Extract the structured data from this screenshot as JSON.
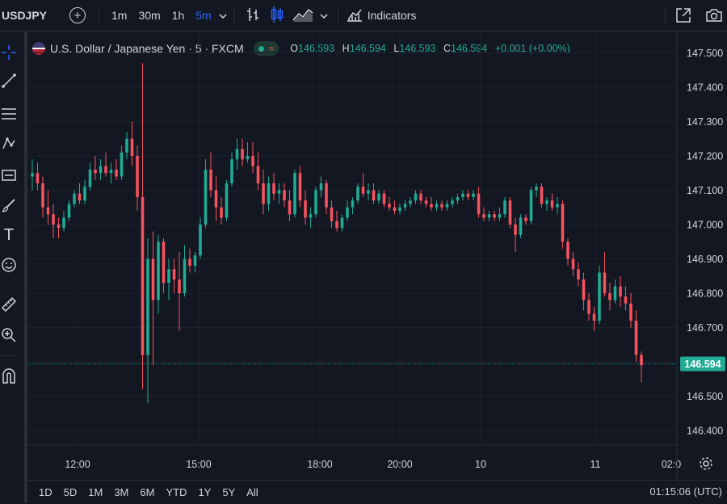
{
  "toolbar": {
    "symbol": "USDJPY",
    "intervals": [
      "1m",
      "30m",
      "1h",
      "5m"
    ],
    "active_interval": "5m",
    "indicators_label": "Indicators"
  },
  "legend": {
    "title": "U.S. Dollar / Japanese Yen · 5 · FXCM",
    "wave_glyph": "≈",
    "open_label": "O",
    "open": "146.593",
    "high_label": "H",
    "high": "146.594",
    "low_label": "L",
    "low": "146.593",
    "close_label": "C",
    "close": "146.594",
    "change": "+0.001 (+0.00%)"
  },
  "bottom": {
    "ranges": [
      "1D",
      "5D",
      "1M",
      "3M",
      "6M",
      "YTD",
      "1Y",
      "5Y",
      "All"
    ],
    "clock": "01:15:06 (UTC)"
  },
  "colors": {
    "background": "#131722",
    "up": "#22ab94",
    "down": "#f7525f",
    "grid": "#1e222d",
    "text": "#d1d4dc",
    "active": "#2962ff"
  },
  "chart_data": {
    "type": "candlestick",
    "title": "U.S. Dollar / Japanese Yen · 5 · FXCM",
    "ylim": [
      146.36,
      147.56
    ],
    "y_ticks": [
      "147.500",
      "147.400",
      "147.300",
      "147.200",
      "147.100",
      "147.000",
      "146.900",
      "146.800",
      "146.700",
      "146.600",
      "146.500",
      "146.400"
    ],
    "x_ticks": [
      "12:00",
      "15:00",
      "18:00",
      "20:00",
      "10",
      "11",
      "02:0"
    ],
    "last_price": "146.594",
    "close_path": [
      147.15,
      147.12,
      147.03,
      146.99,
      147.02,
      147.06,
      147.11,
      147.16,
      147.18,
      147.15,
      147.22,
      147.27,
      147.12,
      146.98,
      146.6,
      146.92,
      146.88,
      146.85,
      146.95,
      147.02,
      147.15,
      147.18,
      147.12,
      147.05,
      147.1,
      147.2,
      147.24,
      147.19,
      147.12,
      147.09,
      147.16,
      147.1,
      147.05,
      147.0,
      147.06,
      147.12,
      147.1,
      147.06,
      147.05,
      147.08,
      147.1,
      147.06,
      147.05,
      147.06,
      147.1,
      147.06,
      147.07,
      147.01,
      147.04,
      147.09,
      147.11,
      147.07,
      146.93,
      146.86,
      146.78,
      146.73,
      146.83,
      146.87,
      146.78,
      146.74,
      146.59
    ],
    "candles": [
      {
        "o": 147.14,
        "h": 147.19,
        "l": 147.1,
        "c": 147.15
      },
      {
        "o": 147.15,
        "h": 147.18,
        "l": 147.1,
        "c": 147.12
      },
      {
        "o": 147.12,
        "h": 147.14,
        "l": 147.02,
        "c": 147.05
      },
      {
        "o": 147.05,
        "h": 147.1,
        "l": 147.0,
        "c": 147.03
      },
      {
        "o": 147.03,
        "h": 147.06,
        "l": 146.96,
        "c": 147.0
      },
      {
        "o": 147.0,
        "h": 147.02,
        "l": 146.96,
        "c": 146.99
      },
      {
        "o": 146.99,
        "h": 147.04,
        "l": 146.98,
        "c": 147.02
      },
      {
        "o": 147.02,
        "h": 147.07,
        "l": 147.01,
        "c": 147.06
      },
      {
        "o": 147.06,
        "h": 147.1,
        "l": 147.05,
        "c": 147.09
      },
      {
        "o": 147.09,
        "h": 147.12,
        "l": 147.06,
        "c": 147.07
      },
      {
        "o": 147.07,
        "h": 147.13,
        "l": 147.06,
        "c": 147.11
      },
      {
        "o": 147.11,
        "h": 147.18,
        "l": 147.1,
        "c": 147.16
      },
      {
        "o": 147.16,
        "h": 147.2,
        "l": 147.13,
        "c": 147.15
      },
      {
        "o": 147.15,
        "h": 147.19,
        "l": 147.13,
        "c": 147.17
      },
      {
        "o": 147.17,
        "h": 147.21,
        "l": 147.14,
        "c": 147.15
      },
      {
        "o": 147.15,
        "h": 147.18,
        "l": 147.12,
        "c": 147.16
      },
      {
        "o": 147.16,
        "h": 147.19,
        "l": 147.13,
        "c": 147.14
      },
      {
        "o": 147.14,
        "h": 147.23,
        "l": 147.13,
        "c": 147.21
      },
      {
        "o": 147.21,
        "h": 147.27,
        "l": 147.19,
        "c": 147.25
      },
      {
        "o": 147.25,
        "h": 147.3,
        "l": 147.17,
        "c": 147.2
      },
      {
        "o": 147.2,
        "h": 147.23,
        "l": 147.04,
        "c": 147.08
      },
      {
        "o": 147.08,
        "h": 147.47,
        "l": 146.52,
        "c": 146.62
      },
      {
        "o": 146.62,
        "h": 146.96,
        "l": 146.48,
        "c": 146.9
      },
      {
        "o": 146.9,
        "h": 146.98,
        "l": 146.59,
        "c": 146.78
      },
      {
        "o": 146.78,
        "h": 146.97,
        "l": 146.74,
        "c": 146.95
      },
      {
        "o": 146.95,
        "h": 146.96,
        "l": 146.8,
        "c": 146.83
      },
      {
        "o": 146.83,
        "h": 146.9,
        "l": 146.78,
        "c": 146.87
      },
      {
        "o": 146.87,
        "h": 146.9,
        "l": 146.8,
        "c": 146.84
      },
      {
        "o": 146.84,
        "h": 146.92,
        "l": 146.69,
        "c": 146.8
      },
      {
        "o": 146.8,
        "h": 146.94,
        "l": 146.79,
        "c": 146.9
      },
      {
        "o": 146.9,
        "h": 146.93,
        "l": 146.86,
        "c": 146.88
      },
      {
        "o": 146.88,
        "h": 146.92,
        "l": 146.86,
        "c": 146.91
      },
      {
        "o": 146.91,
        "h": 147.02,
        "l": 146.9,
        "c": 147.0
      },
      {
        "o": 147.0,
        "h": 147.19,
        "l": 146.99,
        "c": 147.16
      },
      {
        "o": 147.16,
        "h": 147.21,
        "l": 147.08,
        "c": 147.1
      },
      {
        "o": 147.1,
        "h": 147.14,
        "l": 147.01,
        "c": 147.05
      },
      {
        "o": 147.05,
        "h": 147.08,
        "l": 147.0,
        "c": 147.02
      },
      {
        "o": 147.02,
        "h": 147.13,
        "l": 147.01,
        "c": 147.12
      },
      {
        "o": 147.12,
        "h": 147.21,
        "l": 147.11,
        "c": 147.19
      },
      {
        "o": 147.19,
        "h": 147.25,
        "l": 147.16,
        "c": 147.22
      },
      {
        "o": 147.22,
        "h": 147.25,
        "l": 147.17,
        "c": 147.19
      },
      {
        "o": 147.19,
        "h": 147.24,
        "l": 147.18,
        "c": 147.2
      },
      {
        "o": 147.2,
        "h": 147.24,
        "l": 147.15,
        "c": 147.17
      },
      {
        "o": 147.17,
        "h": 147.21,
        "l": 147.1,
        "c": 147.12
      },
      {
        "o": 147.12,
        "h": 147.16,
        "l": 147.03,
        "c": 147.06
      },
      {
        "o": 147.06,
        "h": 147.14,
        "l": 147.04,
        "c": 147.12
      },
      {
        "o": 147.12,
        "h": 147.15,
        "l": 147.07,
        "c": 147.09
      },
      {
        "o": 147.09,
        "h": 147.12,
        "l": 147.06,
        "c": 147.1
      },
      {
        "o": 147.1,
        "h": 147.12,
        "l": 147.05,
        "c": 147.07
      },
      {
        "o": 147.07,
        "h": 147.1,
        "l": 147.01,
        "c": 147.03
      },
      {
        "o": 147.03,
        "h": 147.16,
        "l": 147.02,
        "c": 147.15
      },
      {
        "o": 147.15,
        "h": 147.17,
        "l": 147.05,
        "c": 147.07
      },
      {
        "o": 147.07,
        "h": 147.1,
        "l": 147.0,
        "c": 147.02
      },
      {
        "o": 147.02,
        "h": 147.05,
        "l": 146.99,
        "c": 147.03
      },
      {
        "o": 147.03,
        "h": 147.11,
        "l": 147.02,
        "c": 147.1
      },
      {
        "o": 147.1,
        "h": 147.14,
        "l": 147.08,
        "c": 147.12
      },
      {
        "o": 147.12,
        "h": 147.13,
        "l": 147.03,
        "c": 147.05
      },
      {
        "o": 147.05,
        "h": 147.07,
        "l": 146.99,
        "c": 147.01
      },
      {
        "o": 147.01,
        "h": 147.04,
        "l": 146.98,
        "c": 146.99
      },
      {
        "o": 146.99,
        "h": 147.03,
        "l": 146.98,
        "c": 147.02
      },
      {
        "o": 147.02,
        "h": 147.07,
        "l": 147.01,
        "c": 147.05
      },
      {
        "o": 147.05,
        "h": 147.08,
        "l": 147.03,
        "c": 147.07
      },
      {
        "o": 147.07,
        "h": 147.12,
        "l": 147.06,
        "c": 147.11
      },
      {
        "o": 147.11,
        "h": 147.15,
        "l": 147.08,
        "c": 147.09
      },
      {
        "o": 147.09,
        "h": 147.12,
        "l": 147.07,
        "c": 147.1
      },
      {
        "o": 147.1,
        "h": 147.12,
        "l": 147.06,
        "c": 147.07
      },
      {
        "o": 147.07,
        "h": 147.1,
        "l": 147.06,
        "c": 147.09
      },
      {
        "o": 147.09,
        "h": 147.1,
        "l": 147.05,
        "c": 147.06
      },
      {
        "o": 147.06,
        "h": 147.08,
        "l": 147.04,
        "c": 147.05
      },
      {
        "o": 147.05,
        "h": 147.07,
        "l": 147.03,
        "c": 147.04
      },
      {
        "o": 147.04,
        "h": 147.06,
        "l": 147.03,
        "c": 147.05
      },
      {
        "o": 147.05,
        "h": 147.07,
        "l": 147.04,
        "c": 147.06
      },
      {
        "o": 147.06,
        "h": 147.08,
        "l": 147.05,
        "c": 147.07
      },
      {
        "o": 147.07,
        "h": 147.1,
        "l": 147.06,
        "c": 147.09
      },
      {
        "o": 147.09,
        "h": 147.1,
        "l": 147.06,
        "c": 147.07
      },
      {
        "o": 147.07,
        "h": 147.08,
        "l": 147.05,
        "c": 147.06
      },
      {
        "o": 147.06,
        "h": 147.08,
        "l": 147.04,
        "c": 147.05
      },
      {
        "o": 147.05,
        "h": 147.07,
        "l": 147.04,
        "c": 147.06
      },
      {
        "o": 147.06,
        "h": 147.07,
        "l": 147.04,
        "c": 147.05
      },
      {
        "o": 147.05,
        "h": 147.07,
        "l": 147.04,
        "c": 147.06
      },
      {
        "o": 147.06,
        "h": 147.08,
        "l": 147.05,
        "c": 147.07
      },
      {
        "o": 147.07,
        "h": 147.09,
        "l": 147.06,
        "c": 147.08
      },
      {
        "o": 147.08,
        "h": 147.1,
        "l": 147.07,
        "c": 147.09
      },
      {
        "o": 147.09,
        "h": 147.1,
        "l": 147.07,
        "c": 147.08
      },
      {
        "o": 147.08,
        "h": 147.1,
        "l": 147.07,
        "c": 147.09
      },
      {
        "o": 147.09,
        "h": 147.11,
        "l": 147.02,
        "c": 147.03
      },
      {
        "o": 147.03,
        "h": 147.05,
        "l": 147.01,
        "c": 147.02
      },
      {
        "o": 147.02,
        "h": 147.04,
        "l": 147.01,
        "c": 147.03
      },
      {
        "o": 147.03,
        "h": 147.04,
        "l": 147.01,
        "c": 147.02
      },
      {
        "o": 147.02,
        "h": 147.05,
        "l": 147.01,
        "c": 147.03
      },
      {
        "o": 147.03,
        "h": 147.08,
        "l": 147.02,
        "c": 147.07
      },
      {
        "o": 147.07,
        "h": 147.08,
        "l": 146.99,
        "c": 147.0
      },
      {
        "o": 147.0,
        "h": 147.02,
        "l": 146.92,
        "c": 146.97
      },
      {
        "o": 146.97,
        "h": 147.03,
        "l": 146.96,
        "c": 147.02
      },
      {
        "o": 147.02,
        "h": 147.03,
        "l": 147.0,
        "c": 147.01
      },
      {
        "o": 147.01,
        "h": 147.11,
        "l": 147.0,
        "c": 147.1
      },
      {
        "o": 147.1,
        "h": 147.12,
        "l": 147.08,
        "c": 147.11
      },
      {
        "o": 147.11,
        "h": 147.12,
        "l": 147.05,
        "c": 147.06
      },
      {
        "o": 147.06,
        "h": 147.08,
        "l": 147.04,
        "c": 147.07
      },
      {
        "o": 147.07,
        "h": 147.09,
        "l": 147.04,
        "c": 147.05
      },
      {
        "o": 147.05,
        "h": 147.08,
        "l": 147.03,
        "c": 147.06
      },
      {
        "o": 147.06,
        "h": 147.07,
        "l": 146.93,
        "c": 146.95
      },
      {
        "o": 146.95,
        "h": 146.96,
        "l": 146.88,
        "c": 146.9
      },
      {
        "o": 146.9,
        "h": 146.92,
        "l": 146.85,
        "c": 146.87
      },
      {
        "o": 146.87,
        "h": 146.89,
        "l": 146.82,
        "c": 146.84
      },
      {
        "o": 146.84,
        "h": 146.86,
        "l": 146.75,
        "c": 146.78
      },
      {
        "o": 146.78,
        "h": 146.8,
        "l": 146.72,
        "c": 146.74
      },
      {
        "o": 146.74,
        "h": 146.76,
        "l": 146.69,
        "c": 146.72
      },
      {
        "o": 146.72,
        "h": 146.88,
        "l": 146.71,
        "c": 146.86
      },
      {
        "o": 146.86,
        "h": 146.92,
        "l": 146.79,
        "c": 146.8
      },
      {
        "o": 146.8,
        "h": 146.83,
        "l": 146.75,
        "c": 146.78
      },
      {
        "o": 146.78,
        "h": 146.84,
        "l": 146.77,
        "c": 146.82
      },
      {
        "o": 146.82,
        "h": 146.85,
        "l": 146.76,
        "c": 146.79
      },
      {
        "o": 146.79,
        "h": 146.82,
        "l": 146.75,
        "c": 146.77
      },
      {
        "o": 146.77,
        "h": 146.8,
        "l": 146.7,
        "c": 146.72
      },
      {
        "o": 146.72,
        "h": 146.75,
        "l": 146.6,
        "c": 146.62
      },
      {
        "o": 146.62,
        "h": 146.63,
        "l": 146.54,
        "c": 146.59
      }
    ]
  }
}
